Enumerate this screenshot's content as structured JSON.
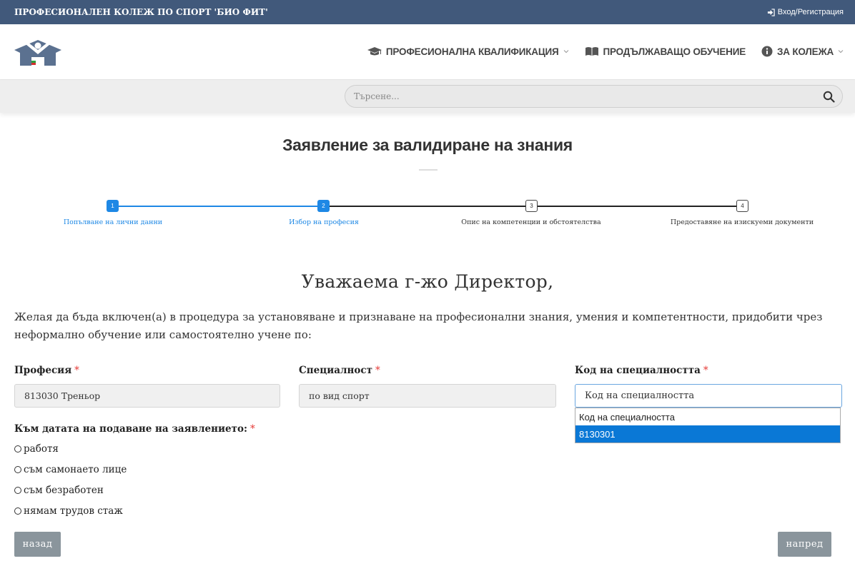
{
  "topbar": {
    "college_name": "ПРОФЕСИОНАЛЕН КОЛЕЖ ПО СПОРТ 'БИО ФИТ'",
    "login_label": "Вход/Регистрация"
  },
  "nav": {
    "items": [
      {
        "label": "ПРОФЕСИОНАЛНА КВАЛИФИКАЦИЯ",
        "icon": "graduation-cap-icon",
        "has_dropdown": true
      },
      {
        "label": "ПРОДЪЛЖАВАЩО ОБУЧЕНИЕ",
        "icon": "book-open-icon",
        "has_dropdown": false
      },
      {
        "label": "ЗА КОЛЕЖА",
        "icon": "info-circle-icon",
        "has_dropdown": true
      }
    ]
  },
  "search": {
    "placeholder": "Търсене..."
  },
  "page": {
    "title": "Заявление за валидиране на знания",
    "salutation": "Уважаема г-жо Директор,",
    "intro": "Желая да бъда включен(а) в процедура за установяване и признаване на професионални знания, умения и компетентности, придобити чрез неформално обучение или самостоятелно учене по:"
  },
  "steps": [
    {
      "number": "1",
      "label": "Попълване на лични данни",
      "state": "done"
    },
    {
      "number": "2",
      "label": "Избор на професия",
      "state": "done"
    },
    {
      "number": "3",
      "label": "Опис на компетенции и обстоятелства",
      "state": "todo"
    },
    {
      "number": "4",
      "label": "Предоставяне на изискуеми документи",
      "state": "todo"
    }
  ],
  "form": {
    "profession": {
      "label": "Професия",
      "required_mark": "*",
      "value": "813030 Треньор"
    },
    "specialty": {
      "label": "Специалност",
      "required_mark": "*",
      "value": "по вид спорт"
    },
    "specialty_code": {
      "label": "Код на специалността",
      "required_mark": "*",
      "value": "Код на специалността",
      "options": [
        "Код на специалността",
        "8130301"
      ],
      "highlighted_option": "8130301"
    },
    "employment": {
      "label": "Към датата на подаване на заявлението:",
      "required_mark": "*",
      "options": [
        "работя",
        "съм самонаето лице",
        "съм безработен",
        "нямам трудов стаж"
      ]
    }
  },
  "buttons": {
    "back": "назад",
    "next": "напред"
  },
  "colors": {
    "topbar": "#41597b",
    "accent": "#1e88e5",
    "required": "#e53935",
    "button": "#8a959c",
    "dropdown_highlight": "#0a78d6"
  }
}
